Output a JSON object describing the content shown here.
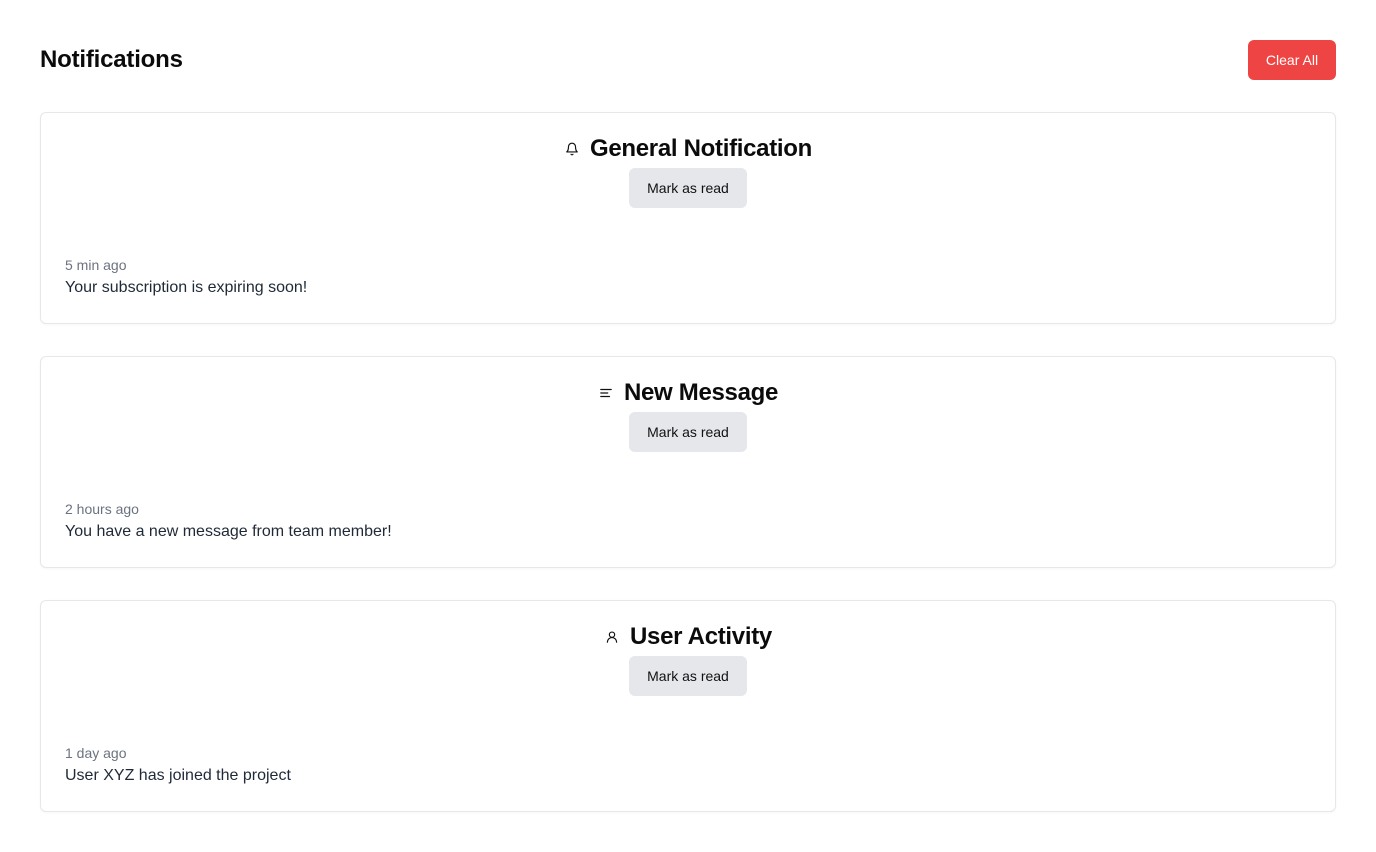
{
  "header": {
    "title": "Notifications",
    "clear_all_label": "Clear All"
  },
  "colors": {
    "clear_all_bg": "#ef4444",
    "mark_read_bg": "#e5e7eb",
    "timestamp": "#6b7280"
  },
  "notifications": [
    {
      "icon": "bell-icon",
      "title": "General Notification",
      "button_label": "Mark as read",
      "time": "5 min ago",
      "message": "Your subscription is expiring soon!"
    },
    {
      "icon": "message-lines-icon",
      "title": "New Message",
      "button_label": "Mark as read",
      "time": "2 hours ago",
      "message": "You have a new message from team member!"
    },
    {
      "icon": "user-icon",
      "title": "User Activity",
      "button_label": "Mark as read",
      "time": "1 day ago",
      "message": "User XYZ has joined the project"
    }
  ]
}
